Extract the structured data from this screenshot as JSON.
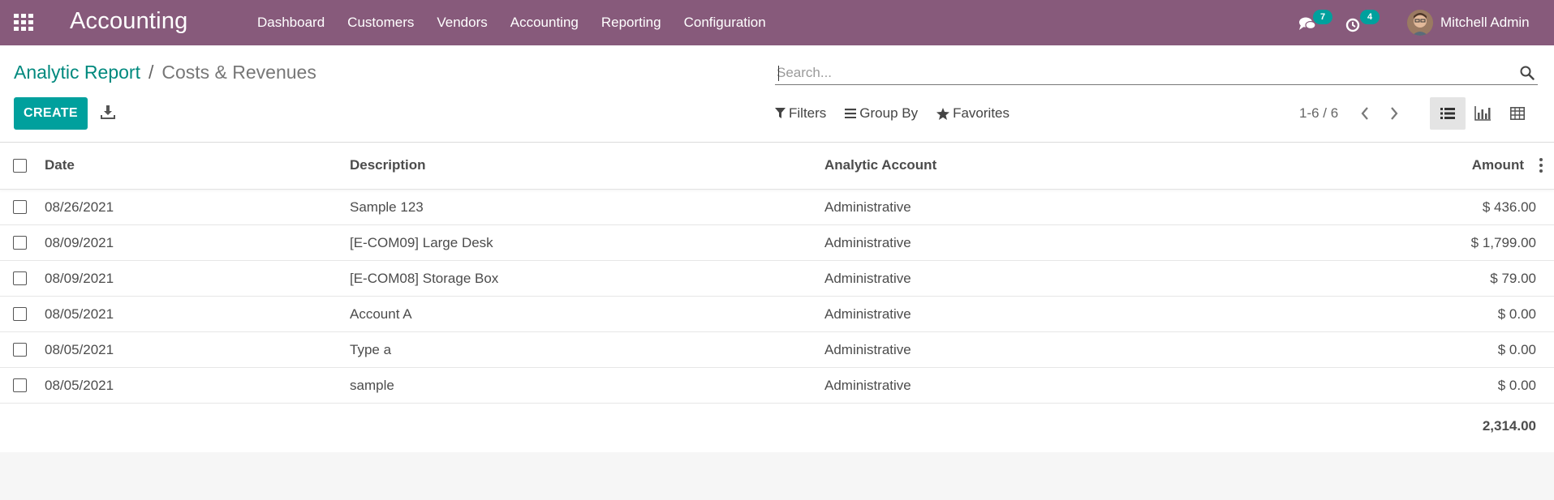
{
  "navbar": {
    "app_title": "Accounting",
    "menu": [
      "Dashboard",
      "Customers",
      "Vendors",
      "Accounting",
      "Reporting",
      "Configuration"
    ],
    "messages_count": "7",
    "activities_count": "4",
    "user_name": "Mitchell Admin",
    "bg_color": "#875a7b"
  },
  "breadcrumb": {
    "parent": "Analytic Report",
    "separator": "/",
    "current": "Costs & Revenues"
  },
  "search": {
    "placeholder": "Search..."
  },
  "toolbar": {
    "create_label": "CREATE",
    "filters_label": "Filters",
    "group_by_label": "Group By",
    "favorites_label": "Favorites",
    "pager": "1-6 / 6",
    "accent_color": "#00a09d"
  },
  "table": {
    "columns": {
      "date": "Date",
      "description": "Description",
      "account": "Analytic Account",
      "amount": "Amount"
    },
    "rows": [
      {
        "date": "08/26/2021",
        "description": "Sample 123",
        "account": "Administrative",
        "amount": "$ 436.00"
      },
      {
        "date": "08/09/2021",
        "description": "[E-COM09] Large Desk",
        "account": "Administrative",
        "amount": "$ 1,799.00"
      },
      {
        "date": "08/09/2021",
        "description": "[E-COM08] Storage Box",
        "account": "Administrative",
        "amount": "$ 79.00"
      },
      {
        "date": "08/05/2021",
        "description": "Account A",
        "account": "Administrative",
        "amount": "$ 0.00"
      },
      {
        "date": "08/05/2021",
        "description": "Type a",
        "account": "Administrative",
        "amount": "$ 0.00"
      },
      {
        "date": "08/05/2021",
        "description": "sample",
        "account": "Administrative",
        "amount": "$ 0.00"
      }
    ],
    "total": "2,314.00"
  }
}
